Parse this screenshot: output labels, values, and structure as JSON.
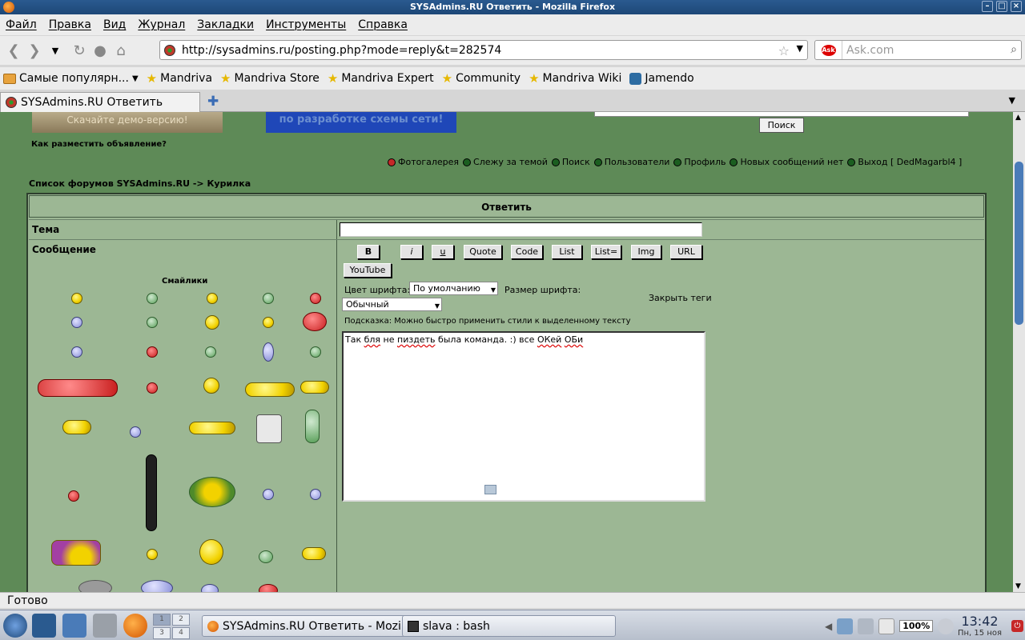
{
  "window": {
    "title": "SYSAdmins.RU Ответить - Mozilla Firefox"
  },
  "menu": [
    "Файл",
    "Правка",
    "Вид",
    "Журнал",
    "Закладки",
    "Инструменты",
    "Справка"
  ],
  "nav": {
    "url": "http://sysadmins.ru/posting.php?mode=reply&t=282574",
    "search_placeholder": "Ask.com"
  },
  "bookmarks": [
    "Самые популярн...",
    "Mandriva",
    "Mandriva Store",
    "Mandriva Expert",
    "Community",
    "Mandriva Wiki",
    "Jamendo"
  ],
  "tabs": [
    {
      "label": "SYSAdmins.RU Ответить"
    }
  ],
  "page": {
    "banner1": "Скачайте демо-версию!",
    "banner2": "по разработке схемы сети!",
    "search_btn": "Поиск",
    "howto": "Как разместить объявление?",
    "links": [
      "Фотогалерея",
      "Слежу за темой",
      "Поиск",
      "Пользователи",
      "Профиль",
      "Новых сообщений нет",
      "Выход [ DedMagarbl4 ]"
    ],
    "breadcrumb": "Список форумов SYSAdmins.RU -> Курилка",
    "form_title": "Ответить",
    "tema_label": "Тема",
    "tema_value": "",
    "msg_label": "Сообщение",
    "smilies_label": "Смайлики",
    "format_buttons": [
      "B",
      "i",
      "u",
      "Quote",
      "Code",
      "List",
      "List=",
      "Img",
      "URL",
      "YouTube"
    ],
    "font_color_label": "Цвет шрифта:",
    "font_color_value": "По умолчанию",
    "font_size_label": "Размер шрифта:",
    "font_size_value": "Обычный",
    "close_tags": "Закрыть теги",
    "hint": "Подсказка: Можно быстро применить стили к выделенному тексту",
    "message": {
      "p1": "Так ",
      "w1": "бля",
      "p2": " не ",
      "w2": "пиздеть",
      "p3": " была команда. :) все ",
      "w3": "ОКей",
      "p4": " ",
      "w4": "ОБи"
    }
  },
  "status": "Готово",
  "taskbar": {
    "pager": [
      "1",
      "2",
      "3",
      "4"
    ],
    "items": [
      "SYSAdmins.RU Ответить - Mozilla Firefox",
      "slava : bash"
    ],
    "zoom": "100%",
    "time": "13:42",
    "date": "Пн, 15 ноя"
  }
}
